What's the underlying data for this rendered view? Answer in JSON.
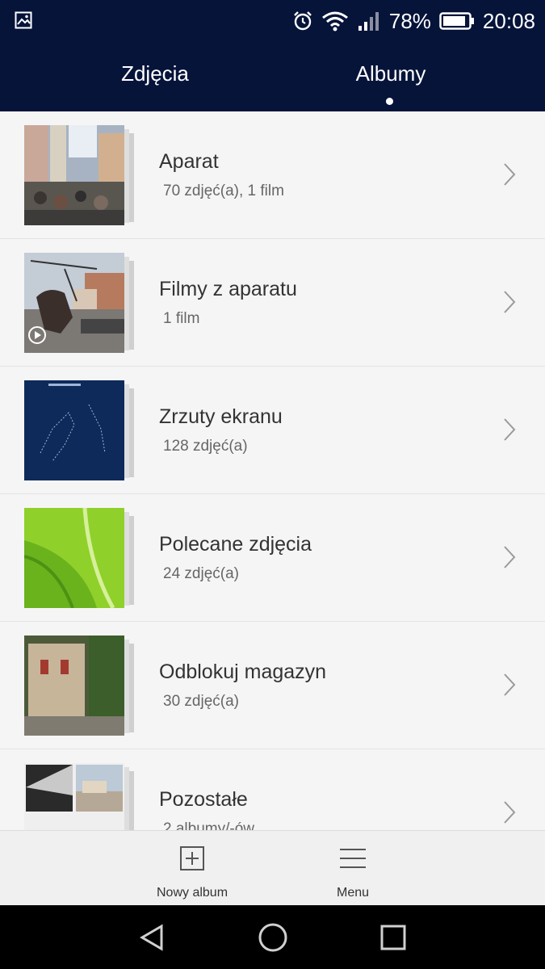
{
  "status_bar": {
    "battery": "78%",
    "time": "20:08",
    "icons": [
      "image-icon",
      "alarm-icon",
      "wifi-icon",
      "signal-icon",
      "battery-icon"
    ]
  },
  "tabs": [
    {
      "label": "Zdjęcia",
      "selected": false
    },
    {
      "label": "Albumy",
      "selected": true
    }
  ],
  "albums": [
    {
      "title": "Aparat",
      "subtitle": "70 zdjęć(a),  1 film"
    },
    {
      "title": "Filmy z aparatu",
      "subtitle": "1 film"
    },
    {
      "title": "Zrzuty ekranu",
      "subtitle": "128 zdjęć(a)"
    },
    {
      "title": "Polecane zdjęcia",
      "subtitle": "24 zdjęć(a)"
    },
    {
      "title": "Odblokuj magazyn",
      "subtitle": "30 zdjęć(a)"
    },
    {
      "title": "Pozostałe",
      "subtitle": "2 albumy/-ów"
    }
  ],
  "actions": {
    "new_album": "Nowy album",
    "menu": "Menu"
  },
  "colors": {
    "header": "#06143a",
    "list_bg": "#f5f5f5"
  }
}
